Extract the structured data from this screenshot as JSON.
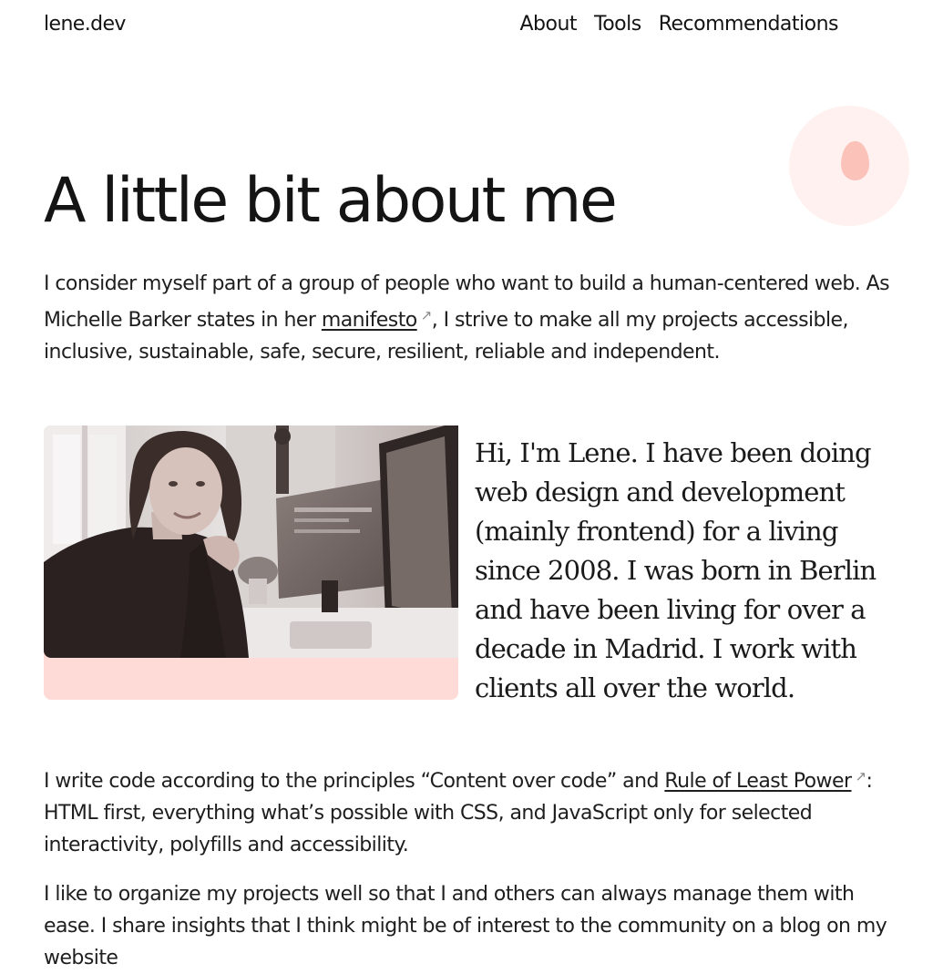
{
  "header": {
    "logo": "lene.dev",
    "nav": [
      {
        "label": "About"
      },
      {
        "label": "Tools"
      },
      {
        "label": "Recommendations"
      }
    ]
  },
  "page": {
    "title": "A little bit about me",
    "intro": {
      "part1": "I consider myself part of a group of people who want to build a human-centered web. As Michelle Barker states in her ",
      "link": "manifesto",
      "part2": ", I strive to make all my projects accessible, inclusive, sustainable, safe, secure, resilient, reliable and independent."
    },
    "bio": "Hi, I'm Lene. I have been doing web design and development (mainly frontend) for a living since 2008. I was born in Berlin and have been living for over a decade in Madrid. I work with clients all over the world.",
    "para1": {
      "part1": "I write code according to the principles “Content over code” and ",
      "link": "Rule of Least Power",
      "part2": ": HTML first, everything what’s possible with CSS, and JavaScript only for selected interactivity, polyfills and accessibility."
    },
    "para2": "I like to organize my projects well so that I and others can always manage them with ease. I share insights that I think might be of interest to the community on a blog on my website"
  },
  "icons": {
    "external_link": "external-link-icon",
    "decoration": "drop-icon"
  },
  "colors": {
    "accent_pink": "#ffdbd7",
    "accent_drop": "#fbc2b9",
    "text": "#1a1a1a"
  }
}
